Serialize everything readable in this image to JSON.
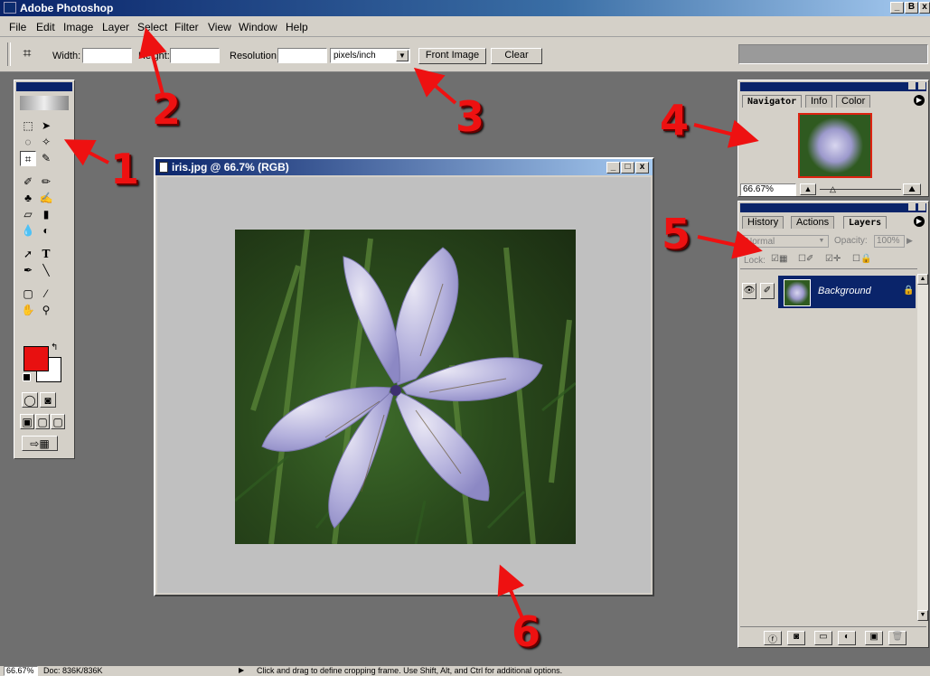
{
  "app": {
    "title": "Adobe Photoshop"
  },
  "window_controls": {
    "minimize": "_",
    "restore": "B",
    "close": "x"
  },
  "menu": [
    "File",
    "Edit",
    "Image",
    "Layer",
    "Select",
    "Filter",
    "View",
    "Window",
    "Help"
  ],
  "options_bar": {
    "width_label": "Width:",
    "width_value": "",
    "height_label": "Height:",
    "height_value": "",
    "resolution_label": "Resolution:",
    "resolution_value": "",
    "units_value": "pixels/inch",
    "front_image_label": "Front Image",
    "clear_label": "Clear"
  },
  "document": {
    "title": "iris.jpg @ 66.7% (RGB)",
    "controls": [
      "_",
      "□",
      "x"
    ]
  },
  "navigator": {
    "tabs": [
      "Navigator",
      "Info",
      "Color"
    ],
    "active_tab": "Navigator",
    "zoom_value": "66.67%"
  },
  "layers_panel": {
    "tabs": [
      "History",
      "Actions",
      "Layers"
    ],
    "active_tab": "Layers",
    "blend_mode": "Normal",
    "opacity_label": "Opacity:",
    "opacity_value": "100%",
    "lock_label": "Lock:",
    "layers": [
      {
        "name": "Background",
        "selected": true
      }
    ]
  },
  "status": {
    "zoom": "66.67%",
    "doc_info": "Doc: 836K/836K",
    "hint": "Click and drag to define cropping frame. Use Shift, Alt, and Ctrl for additional options."
  },
  "annotations": [
    "1",
    "2",
    "3",
    "4",
    "5",
    "6"
  ],
  "colors": {
    "accent_titlebar": "#0a246a",
    "foreground_color": "#e81010",
    "background_color": "#ffffff",
    "annotation_red": "#e11111",
    "layer_selected": "#0a246a"
  }
}
